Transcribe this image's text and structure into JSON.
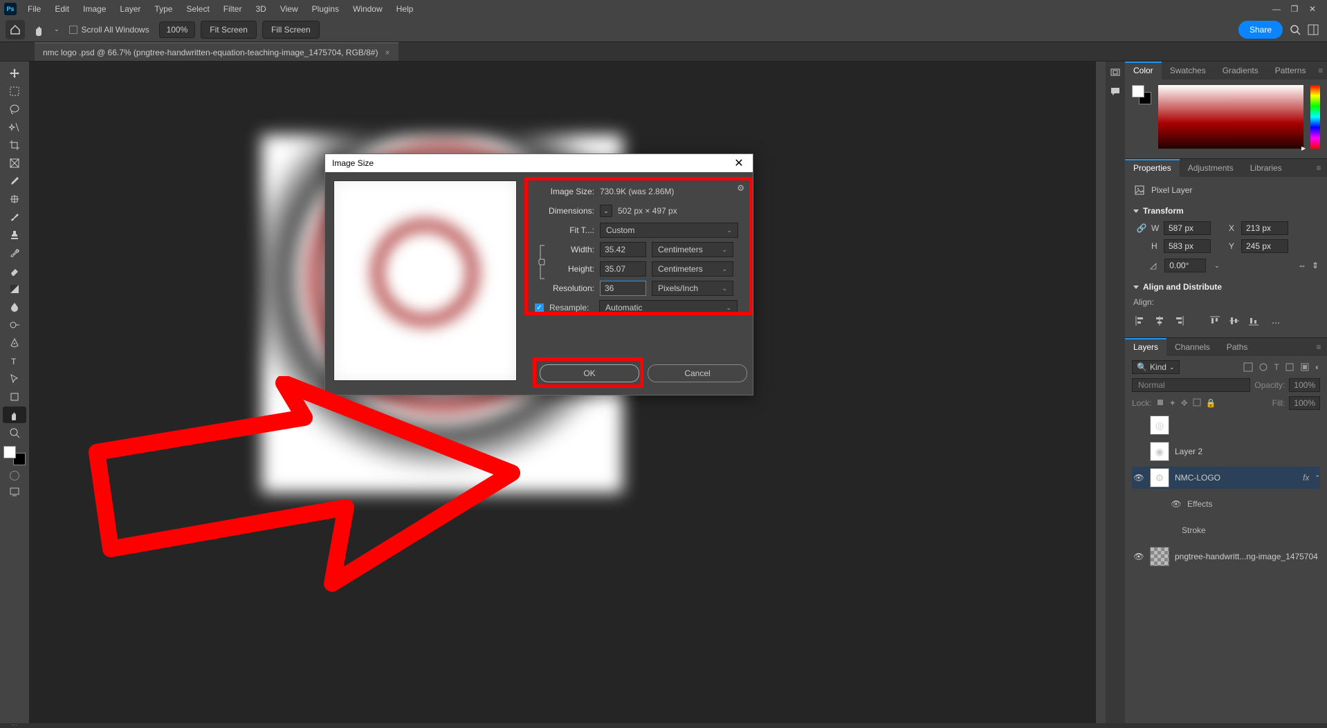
{
  "menu": [
    "File",
    "Edit",
    "Image",
    "Layer",
    "Type",
    "Select",
    "Filter",
    "3D",
    "View",
    "Plugins",
    "Window",
    "Help"
  ],
  "options": {
    "scroll_all": "Scroll All Windows",
    "zoom": "100%",
    "fit_screen": "Fit Screen",
    "fill_screen": "Fill Screen",
    "share": "Share"
  },
  "doc_tab": "nmc logo .psd @ 66.7% (pngtree-handwritten-equation-teaching-image_1475704, RGB/8#)",
  "panels": {
    "color_tabs": [
      "Color",
      "Swatches",
      "Gradients",
      "Patterns"
    ],
    "props_tabs": [
      "Properties",
      "Adjustments",
      "Libraries"
    ],
    "layers_tabs": [
      "Layers",
      "Channels",
      "Paths"
    ]
  },
  "props": {
    "layer_type": "Pixel Layer",
    "transform_title": "Transform",
    "W_l": "W",
    "H_l": "H",
    "X_l": "X",
    "Y_l": "Y",
    "W": "587 px",
    "H": "583 px",
    "X": "213 px",
    "Y": "245 px",
    "angle": "0.00°",
    "ad_title": "Align and Distribute",
    "align": "Align:"
  },
  "layers": {
    "kind": "Kind",
    "normal": "Normal",
    "opacity_l": "Opacity:",
    "opacity": "100%",
    "lock_l": "Lock:",
    "fill_l": "Fill:",
    "fill": "100%",
    "items": [
      {
        "name": "",
        "eye": false,
        "thumb": "circle"
      },
      {
        "name": "Layer 2",
        "eye": false,
        "thumb": "circle"
      },
      {
        "name": "NMC-LOGO",
        "eye": true,
        "thumb": "logo",
        "fx": true,
        "sel": true
      },
      {
        "name": "pngtree-handwritt...ng-image_1475704",
        "eye": true,
        "thumb": "checker"
      }
    ],
    "effects": "Effects",
    "stroke": "Stroke"
  },
  "dialog": {
    "title": "Image Size",
    "image_size_l": "Image Size:",
    "image_size": "730.9K (was 2.86M)",
    "dimensions_l": "Dimensions:",
    "dimensions": "502 px  ×  497 px",
    "fit_to_l": "Fit T...:",
    "fit_to": "Custom",
    "width_l": "Width:",
    "width": "35.42",
    "height_l": "Height:",
    "height": "35.07",
    "reso_l": "Resolution:",
    "reso": "36",
    "unit_cm": "Centimeters",
    "unit_ppi": "Pixels/Inch",
    "resample_l": "Resample:",
    "resample": "Automatic",
    "ok": "OK",
    "cancel": "Cancel"
  }
}
